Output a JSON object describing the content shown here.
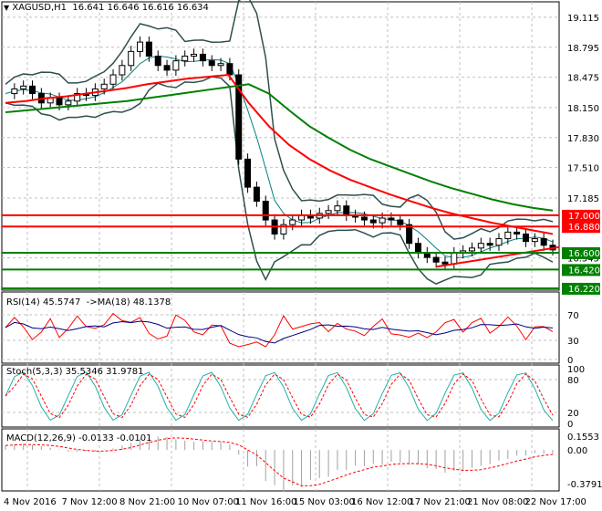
{
  "header": {
    "arrow": "▼",
    "symbol": "XAGUSD,H1",
    "ohlc": "16.641 16.646 16.616 16.634"
  },
  "panels": {
    "rsi_title": "RSI(14) 45.5747  ->MA(18) 48.1378",
    "stoch_title": "Stoch(5,3,3) 35.5346 31.9781",
    "macd_title": "MACD(12,26,9) -0.0133 -0.0101"
  },
  "chart_data": {
    "type": "line",
    "title": "XAGUSD,H1",
    "price_ticks": [
      "19.115",
      "18.795",
      "18.475",
      "18.150",
      "17.830",
      "17.510",
      "17.185",
      "16.545"
    ],
    "price_tick_values": [
      19.115,
      18.795,
      18.475,
      18.15,
      17.83,
      17.51,
      17.185,
      16.545
    ],
    "ylim": [
      16.2,
      19.28
    ],
    "levels": [
      {
        "label": "17.000",
        "value": 17.0,
        "color": "#ff0000"
      },
      {
        "label": "16.880",
        "value": 16.88,
        "color": "#ff0000"
      },
      {
        "label": "16.600",
        "value": 16.6,
        "color": "#008000"
      },
      {
        "label": "16.420",
        "value": 16.42,
        "color": "#008000"
      },
      {
        "label": "16.220",
        "value": 16.22,
        "color": "#008000"
      }
    ],
    "x_labels": [
      "4 Nov 2016",
      "7 Nov 12:00",
      "8 Nov 21:00",
      "10 Nov 07:00",
      "11 Nov 16:00",
      "15 Nov 03:00",
      "16 Nov 12:00",
      "17 Nov 21:00",
      "21 Nov 08:00",
      "22 Nov 17:00"
    ],
    "close": [
      18.3,
      18.35,
      18.38,
      18.3,
      18.2,
      18.25,
      18.18,
      18.22,
      18.3,
      18.28,
      18.35,
      18.4,
      18.5,
      18.6,
      18.75,
      18.85,
      18.7,
      18.6,
      18.55,
      18.65,
      18.7,
      18.72,
      18.65,
      18.6,
      18.62,
      18.5,
      17.6,
      17.3,
      17.15,
      16.95,
      16.8,
      16.9,
      16.95,
      17.0,
      16.97,
      17.02,
      17.05,
      17.1,
      17.0,
      16.98,
      16.95,
      16.92,
      16.97,
      16.95,
      16.9,
      16.7,
      16.6,
      16.55,
      16.5,
      16.48,
      16.6,
      16.62,
      16.65,
      16.7,
      16.68,
      16.75,
      16.82,
      16.8,
      16.72,
      16.75,
      16.68,
      16.63
    ],
    "ma_red": [
      18.2,
      18.22,
      18.25,
      18.27,
      18.3,
      18.33,
      18.36,
      18.4,
      18.43,
      18.46,
      18.48,
      18.5,
      18.2,
      17.95,
      17.75,
      17.6,
      17.48,
      17.38,
      17.3,
      17.22,
      17.15,
      17.08,
      17.02,
      16.97,
      16.92,
      16.88,
      16.84,
      16.8
    ],
    "ma_green": [
      18.1,
      18.12,
      18.14,
      18.16,
      18.18,
      18.2,
      18.22,
      18.25,
      18.28,
      18.31,
      18.34,
      18.37,
      18.4,
      18.3,
      18.12,
      17.95,
      17.82,
      17.7,
      17.6,
      17.52,
      17.44,
      17.36,
      17.29,
      17.23,
      17.17,
      17.12,
      17.08,
      17.05
    ],
    "rsi_ticks": [
      "70",
      "30",
      "0"
    ],
    "stoch_ticks": [
      "100",
      "80",
      "20",
      "0"
    ],
    "macd_ticks": [
      "0.1553",
      "0.00",
      "-0.3791"
    ],
    "rsi_top": "100"
  },
  "colors": {
    "bg": "#ffffff",
    "grid": "#c0c0c0",
    "red": "#ff0000",
    "green": "#008000",
    "navy": "#000080",
    "teal": "#20b2aa"
  }
}
